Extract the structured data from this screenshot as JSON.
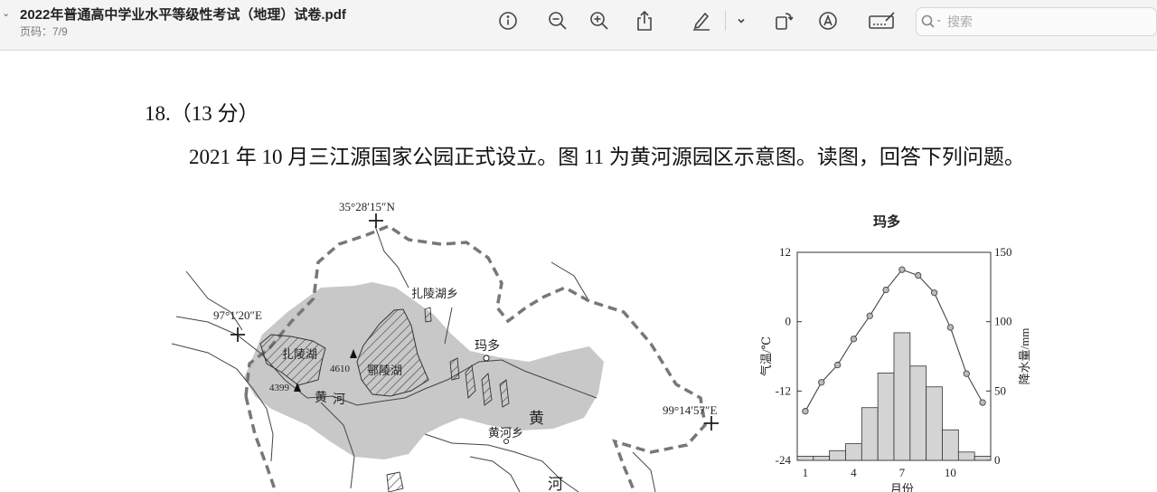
{
  "toolbar": {
    "title": "2022年普通高中学业水平等级性考试（地理）试卷.pdf",
    "page_indicator": "页码：7/9",
    "search_placeholder": "搜索",
    "icons": [
      "info-icon",
      "zoom-out-icon",
      "zoom-in-icon",
      "share-icon",
      "highlight-pen-icon",
      "chevron-down-icon",
      "rotate-icon",
      "markup-icon",
      "sign-icon",
      "search-icon"
    ]
  },
  "question": {
    "number": "18.（13 分）",
    "text": "2021 年 10 月三江源国家公园正式设立。图 11 为黄河源园区示意图。读图，回答下列问题。"
  },
  "map": {
    "coord_north": "35°28′15″N",
    "coord_west": "97°1′20″E",
    "coord_east": "99°14′57″E",
    "lake_zaling": "扎陵湖",
    "lake_eling": "鄂陵湖",
    "town_zalinghu": "扎陵湖乡",
    "town_maduo": "玛多",
    "town_huanghe": "黄河乡",
    "peak_1": "4610",
    "peak_2": "4399",
    "river_label_1": "黄",
    "river_label_2": "河",
    "river_label_3": "黄",
    "river_label_4": "河"
  },
  "climate": {
    "title": "玛多",
    "left_axis_label": "气温/℃",
    "right_axis_label": "降水量/mm",
    "x_label": "月份",
    "left_ticks": [
      "12",
      "0",
      "-12",
      "-24"
    ],
    "right_ticks": [
      "150",
      "100",
      "50",
      "0"
    ],
    "x_ticks": [
      "1",
      "4",
      "7",
      "10"
    ]
  },
  "chart_data": {
    "type": "bar",
    "title": "玛多",
    "xlabel": "月份",
    "ylabel": "气温/℃",
    "y2label": "降水量/mm",
    "categories": [
      1,
      2,
      3,
      4,
      5,
      6,
      7,
      8,
      9,
      10,
      11,
      12
    ],
    "series": [
      {
        "axis": "right",
        "type": "bar",
        "values": [
          3,
          3,
          7,
          12,
          38,
          63,
          92,
          68,
          53,
          22,
          6,
          3
        ]
      },
      {
        "axis": "left",
        "type": "line",
        "values": [
          -15.5,
          -10.5,
          -7.5,
          -3,
          1,
          5.5,
          9,
          8,
          5,
          -1,
          -9,
          -14
        ]
      }
    ],
    "ylim": [
      -24,
      12
    ],
    "y2lim": [
      0,
      150
    ],
    "grid": false
  }
}
